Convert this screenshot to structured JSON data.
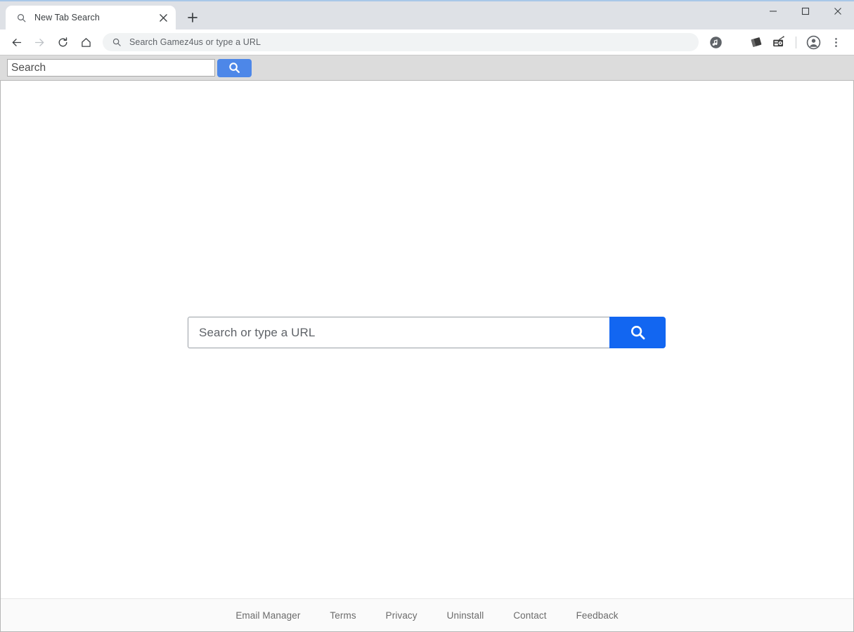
{
  "browser": {
    "titlebar_color": "#dee1e6",
    "accent_top_line": "#a8c7e8",
    "tab": {
      "title": "New Tab Search",
      "favicon": "search-icon",
      "close": "close-icon"
    },
    "new_tab_button": "plus-icon",
    "window_controls": {
      "minimize": "minimize-icon",
      "maximize": "maximize-icon",
      "close": "close-icon"
    },
    "nav": {
      "back": "back-arrow-icon",
      "forward": "forward-arrow-icon",
      "reload": "reload-icon",
      "home": "home-icon"
    },
    "omnibox": {
      "icon": "search-icon",
      "placeholder": "Search Gamez4us or type a URL",
      "value": ""
    },
    "extensions": [
      {
        "name": "music-note-icon"
      },
      {
        "name": "tilted-card-icon"
      },
      {
        "name": "radio-icon"
      }
    ],
    "profile_icon": "account-circle-icon",
    "menu_icon": "three-dot-menu-icon"
  },
  "ext_toolbar": {
    "background": "#dcdcdc",
    "search_placeholder": "Search",
    "search_value": "",
    "button_icon": "search-icon",
    "button_color": "#4d87e8"
  },
  "page": {
    "search": {
      "placeholder": "Search or type a URL",
      "value": "",
      "button_icon": "search-icon",
      "button_color": "#1266f1"
    },
    "footer": {
      "links": [
        {
          "label": "Email Manager"
        },
        {
          "label": "Terms"
        },
        {
          "label": "Privacy"
        },
        {
          "label": "Uninstall"
        },
        {
          "label": "Contact"
        },
        {
          "label": "Feedback"
        }
      ]
    }
  }
}
